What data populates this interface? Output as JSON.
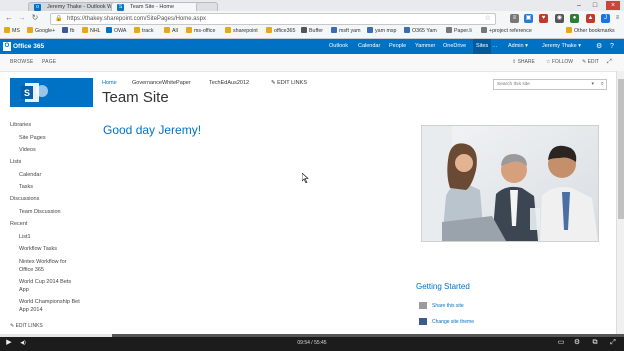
{
  "browser": {
    "tabs": [
      {
        "title": "Jeremy Thake - Outlook W",
        "active": false
      },
      {
        "title": "Team Site - Home",
        "active": true
      }
    ],
    "url": "https://thakey.sharepoint.com/SitePages/Home.aspx",
    "bookmarks": [
      "MS",
      "Google+",
      "fb",
      "NHL",
      "OWA",
      "track",
      "All",
      "ms-office",
      "sharepoint",
      "office365",
      "Buffer",
      "msft yam",
      "yam msp",
      "O365 Yam",
      "Paper.li",
      "+project reference"
    ],
    "other_bookmarks": "Other bookmarks",
    "user_initial": "J"
  },
  "suite": {
    "logo": "Office 365",
    "links": [
      "Outlook",
      "Calendar",
      "People",
      "Yammer",
      "OneDrive",
      "Sites"
    ],
    "active_link": "Sites",
    "admin": "Admin",
    "user": "Jeremy Thake"
  },
  "ribbon": {
    "tabs": [
      "BROWSE",
      "PAGE"
    ],
    "actions": [
      "SHARE",
      "FOLLOW",
      "EDIT"
    ]
  },
  "site": {
    "topnav": [
      "Home",
      "GovernanceWhitePaper",
      "TechEdAus2012"
    ],
    "edit_links": "EDIT LINKS",
    "title": "Team Site",
    "search_placeholder": "Search this site",
    "greeting": "Good day Jeremy!"
  },
  "quicklaunch": [
    {
      "label": "Libraries",
      "level": 0
    },
    {
      "label": "Site Pages",
      "level": 1
    },
    {
      "label": "Videos",
      "level": 1
    },
    {
      "label": "Lists",
      "level": 0
    },
    {
      "label": "Calendar",
      "level": 1
    },
    {
      "label": "Tasks",
      "level": 1
    },
    {
      "label": "Discussions",
      "level": 0
    },
    {
      "label": "Team Discussion",
      "level": 1
    },
    {
      "label": "Recent",
      "level": 0
    },
    {
      "label": "List1",
      "level": 1
    },
    {
      "label": "Workflow Tasks",
      "level": 1
    },
    {
      "label": "Nintex Workflow for Office 365",
      "level": 1
    },
    {
      "label": "World Cup 2014 Bets App",
      "level": 1
    },
    {
      "label": "World Championship Bet App 2014",
      "level": 1
    }
  ],
  "quicklaunch_edit": "EDIT LINKS",
  "getting_started": {
    "title": "Getting Started",
    "items": [
      "Share this site",
      "Change site theme"
    ]
  },
  "player": {
    "timecode": "09:54 / 55:45",
    "progress": 0.18
  },
  "colors": {
    "brand": "#0072c6",
    "suitebar": "#0072c6",
    "player": "#1c1c1c"
  }
}
